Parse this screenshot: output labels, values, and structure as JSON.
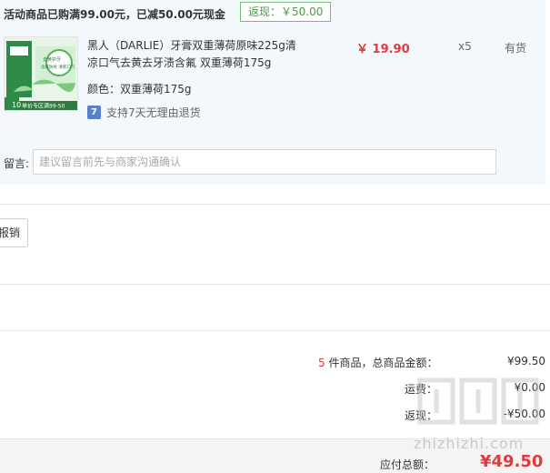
{
  "promo": {
    "title": "活动商品已购满99.00元，已减50.00元现金",
    "rebate_tag": "返现：￥50.00"
  },
  "item": {
    "thumb_text_top": "去黄护牙",
    "thumb_text_mid": "含氟防蛀 清新口气",
    "thumb_price_badge": "10",
    "thumb_banner": "单价专区满99-50",
    "name": "黑人（DARLIE）牙膏双重薄荷原味225g清凉口气去黄去牙渍含氟 双重薄荷175g",
    "color_label": "颜色：双重薄荷175g",
    "return_icon": "7",
    "return_note": "支持7天无理由退货",
    "price": "￥ 19.90",
    "qty": "x5",
    "stock": "有货"
  },
  "remark": {
    "label": "留言:",
    "placeholder": "建议留言前先与商家沟通确认"
  },
  "invoice": {
    "button_label": "报销"
  },
  "summary": {
    "count": "5",
    "count_suffix": " 件商品，总商品金额：",
    "total": "¥99.50",
    "shipping_label": "运费：",
    "shipping": "¥0.00",
    "rebate_label": "返现：",
    "rebate": "-¥50.00",
    "due_label": "应付总额：",
    "due": "¥49.50"
  },
  "watermark": {
    "text": "zhizhizhi.com"
  },
  "colors": {
    "accent_red": "#e4393c",
    "promo_green": "#4a9a4a",
    "panel_bg": "#f3f8fc"
  }
}
